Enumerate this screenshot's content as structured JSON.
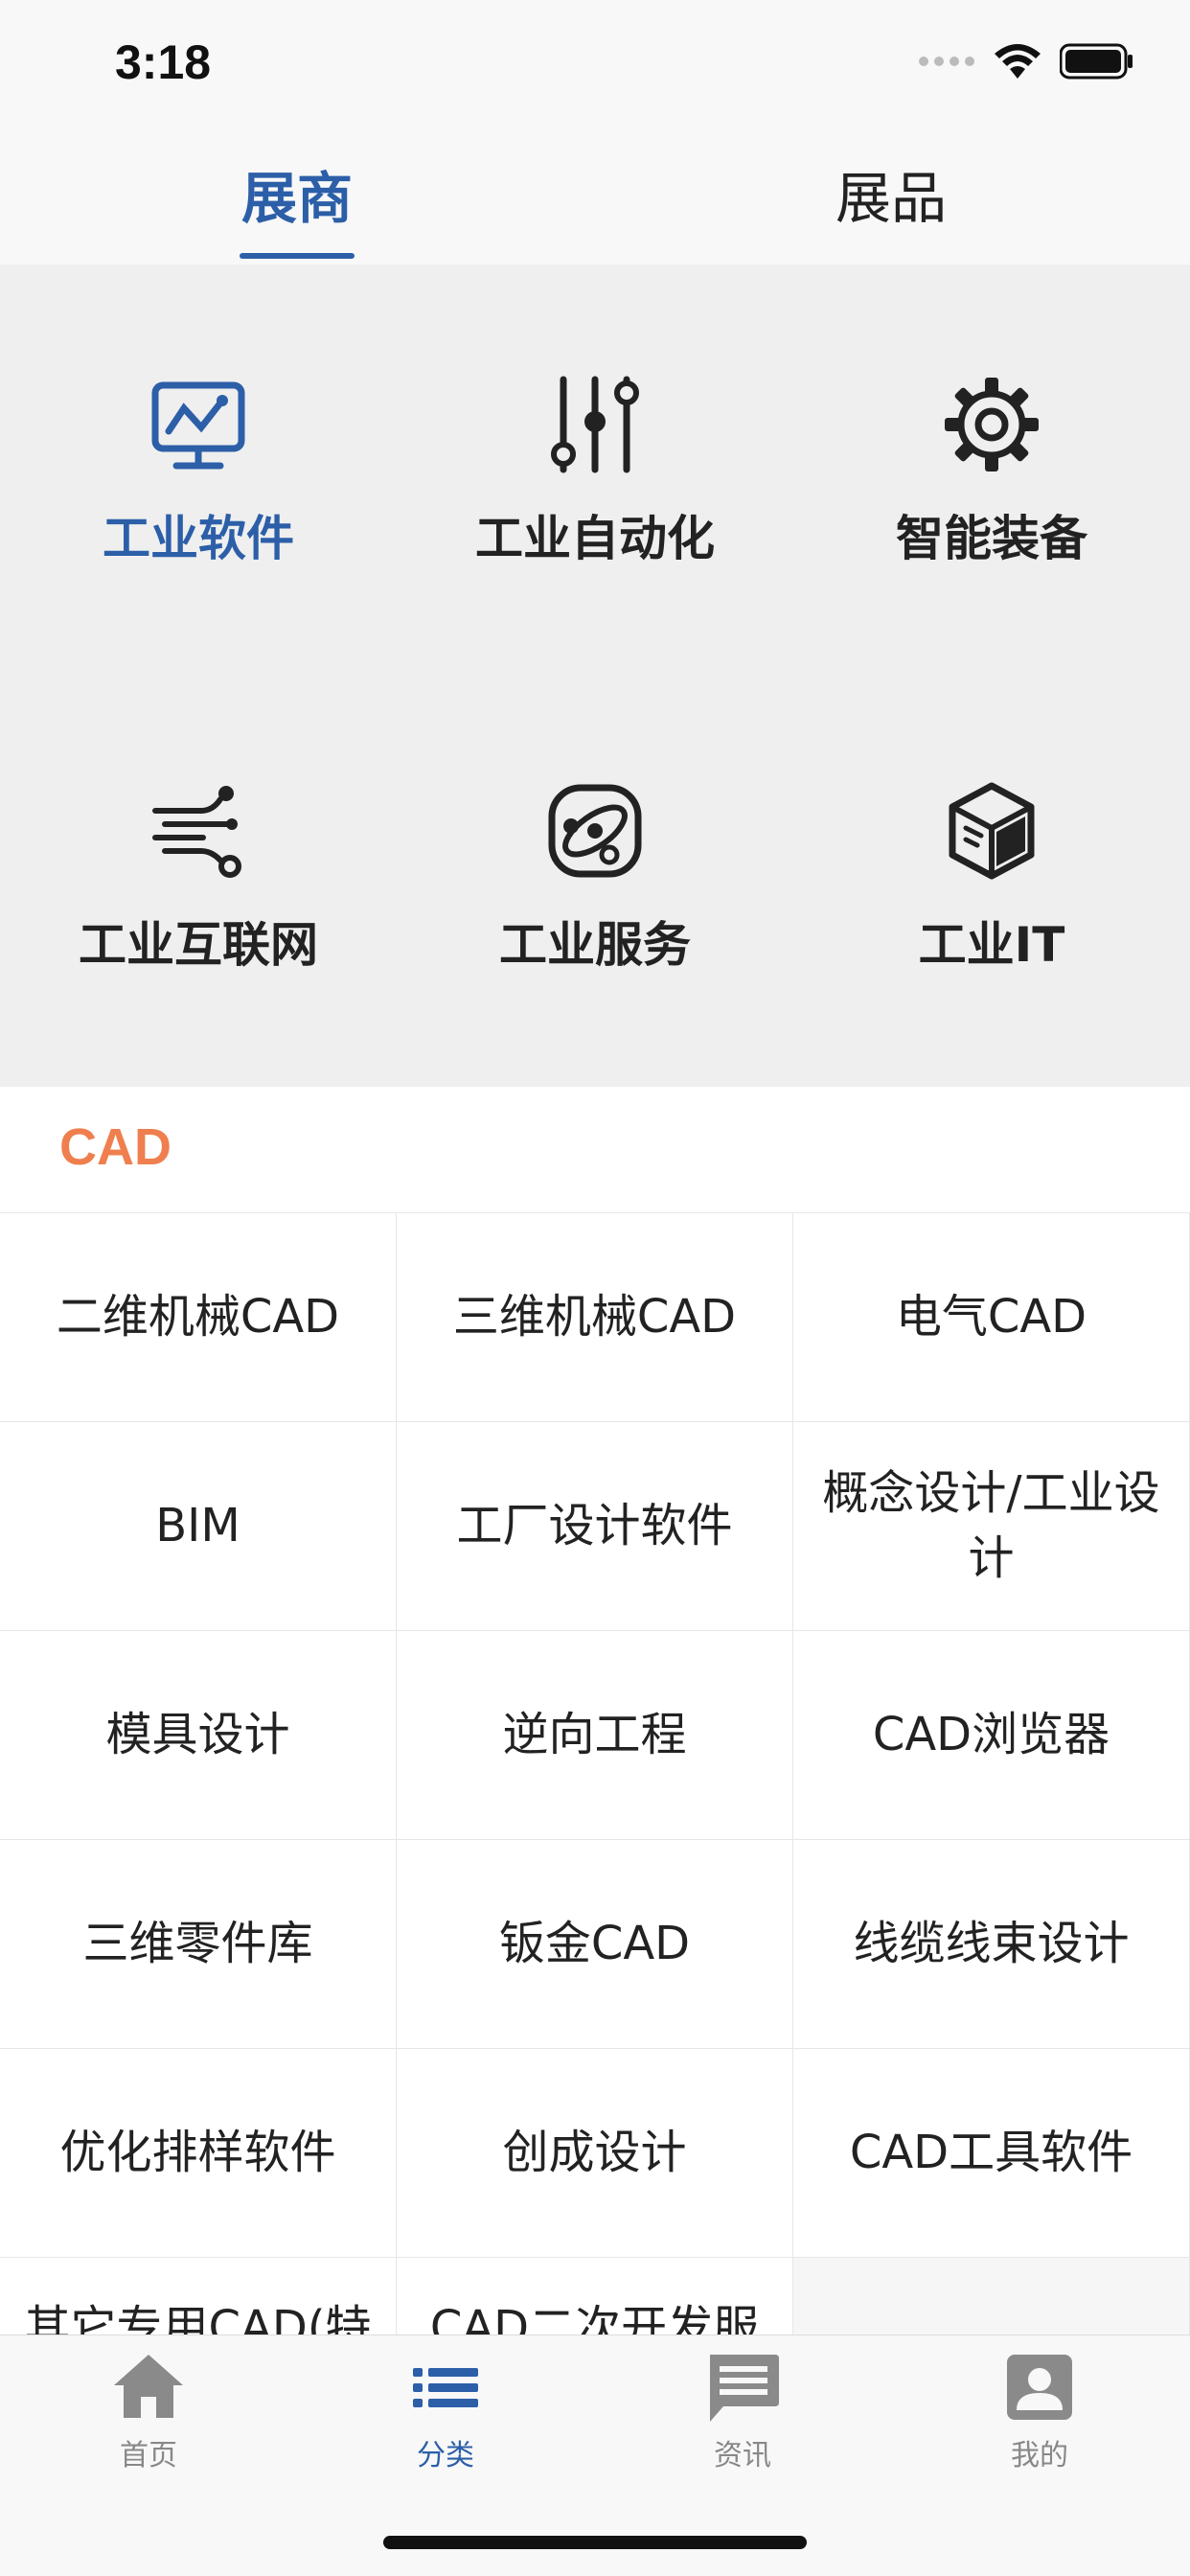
{
  "status": {
    "time": "3:18"
  },
  "top_tabs": [
    {
      "label": "展商",
      "active": true
    },
    {
      "label": "展品",
      "active": false
    }
  ],
  "categories": [
    {
      "label": "工业软件",
      "icon": "monitor-chart-icon",
      "active": true
    },
    {
      "label": "工业自动化",
      "icon": "sliders-icon",
      "active": false
    },
    {
      "label": "智能装备",
      "icon": "gear-icon",
      "active": false
    },
    {
      "label": "工业互联网",
      "icon": "network-lines-icon",
      "active": false
    },
    {
      "label": "工业服务",
      "icon": "atom-icon",
      "active": false
    },
    {
      "label": "工业IT",
      "icon": "cube-icon",
      "active": false
    }
  ],
  "section": {
    "title": "CAD"
  },
  "subcategories": [
    "二维机械CAD",
    "三维机械CAD",
    "电气CAD",
    "BIM",
    "工厂设计软件",
    "概念设计/工业设计",
    "模具设计",
    "逆向工程",
    "CAD浏览器",
    "三维零件库",
    "钣金CAD",
    "线缆线束设计",
    "优化排样软件",
    "创成设计",
    "CAD工具软件",
    "其它专用CAD(特",
    "CAD二次开发服",
    ""
  ],
  "bottom_nav": [
    {
      "label": "首页",
      "icon": "home-icon",
      "active": false
    },
    {
      "label": "分类",
      "icon": "list-icon",
      "active": true
    },
    {
      "label": "资讯",
      "icon": "message-icon",
      "active": false
    },
    {
      "label": "我的",
      "icon": "profile-icon",
      "active": false
    }
  ],
  "colors": {
    "accent": "#2c5fa8",
    "section_title": "#ef7f4e",
    "grid_bg": "#efefef"
  }
}
